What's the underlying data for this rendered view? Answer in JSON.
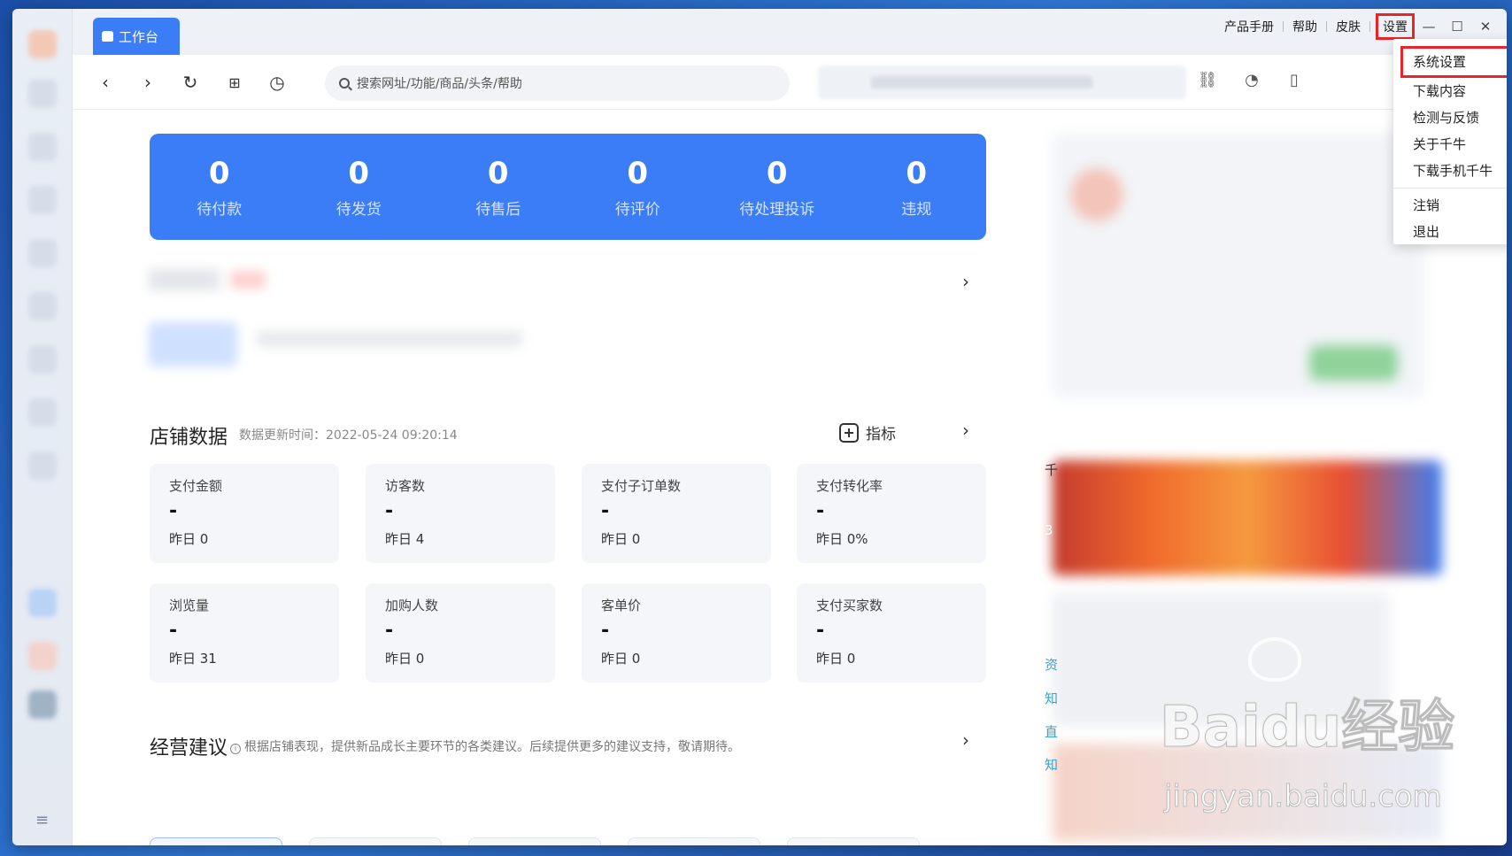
{
  "titlebar": {
    "home_tab": "工作台",
    "links": [
      "产品手册",
      "帮助",
      "皮肤"
    ],
    "settings": "设置"
  },
  "toolbar": {
    "search_placeholder": "搜索网址/功能/商品/头条/帮助"
  },
  "stats": [
    {
      "value": "0",
      "label": "待付款"
    },
    {
      "value": "0",
      "label": "待发货"
    },
    {
      "value": "0",
      "label": "待售后"
    },
    {
      "value": "0",
      "label": "待评价"
    },
    {
      "value": "0",
      "label": "待处理投诉"
    },
    {
      "value": "0",
      "label": "违规"
    }
  ],
  "store_data": {
    "title": "店铺数据",
    "update_time": "数据更新时间：2022-05-24 09:20:14",
    "index_label": "指标",
    "metrics": [
      {
        "name": "支付金额",
        "value": "-",
        "yesterday": "昨日 0"
      },
      {
        "name": "访客数",
        "value": "-",
        "yesterday": "昨日 4"
      },
      {
        "name": "支付子订单数",
        "value": "-",
        "yesterday": "昨日 0"
      },
      {
        "name": "支付转化率",
        "value": "-",
        "yesterday": "昨日 0%"
      },
      {
        "name": "浏览量",
        "value": "-",
        "yesterday": "昨日 31"
      },
      {
        "name": "加购人数",
        "value": "-",
        "yesterday": "昨日 0"
      },
      {
        "name": "客单价",
        "value": "-",
        "yesterday": "昨日 0"
      },
      {
        "name": "支付买家数",
        "value": "-",
        "yesterday": "昨日 0"
      }
    ]
  },
  "advice": {
    "title": "经营建议",
    "desc": "根据店铺表现，提供新品成长主要环节的各类建议。后续提供更多的建议支持，敬请期待。"
  },
  "right_edge_chars": [
    "千",
    "3",
    "资",
    "知",
    "直",
    "知"
  ],
  "dropdown": {
    "items": [
      "系统设置",
      "下载内容",
      "检测与反馈",
      "关于千牛",
      "下载手机千牛"
    ],
    "items2": [
      "注销",
      "退出"
    ]
  },
  "watermark": {
    "brand": "Bai",
    "brand2": "du",
    "cn": "经验",
    "url": "jingyan.baidu.com"
  },
  "colors": {
    "accent": "#3a7df6",
    "highlight": "#e8262a"
  }
}
